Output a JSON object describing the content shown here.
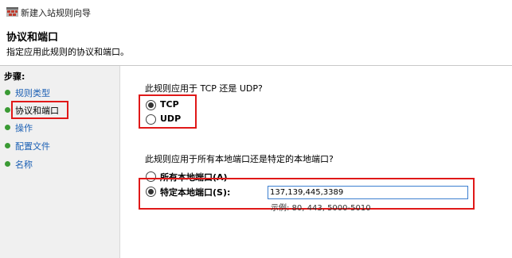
{
  "window": {
    "title": "新建入站规则向导",
    "icon": "firewall-wizard-icon"
  },
  "header": {
    "title": "协议和端口",
    "description": "指定应用此规则的协议和端口。"
  },
  "sidebar": {
    "title": "步骤:",
    "items": [
      {
        "label": "规则类型"
      },
      {
        "label": "协议和端口",
        "current": true
      },
      {
        "label": "操作"
      },
      {
        "label": "配置文件"
      },
      {
        "label": "名称"
      }
    ]
  },
  "protocol": {
    "question": "此规则应用于 TCP 还是 UDP?",
    "options": [
      {
        "label": "TCP",
        "selected": true
      },
      {
        "label": "UDP",
        "selected": false
      }
    ]
  },
  "ports": {
    "question": "此规则应用于所有本地端口还是特定的本地端口?",
    "options": [
      {
        "label": "所有本地端口(A)",
        "selected": false
      },
      {
        "label": "特定本地端口(S):",
        "selected": true
      }
    ],
    "value": "137,139,445,3389",
    "example": "示例: 80, 443, 5000-5010"
  },
  "colors": {
    "highlight": "#e01818",
    "link": "#1a5fb4",
    "step_dot": "#3a9a34",
    "sidebar_bg": "#f0f0f0"
  }
}
